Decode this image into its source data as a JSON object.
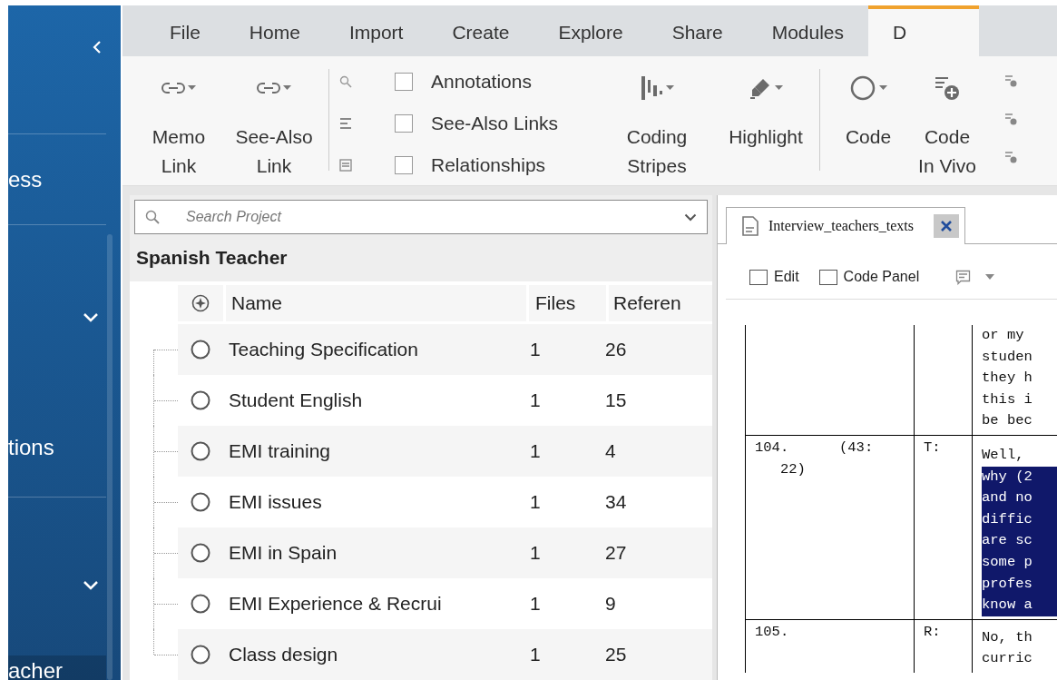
{
  "sidebar": {
    "items": [
      {
        "kind": "heading",
        "label": "ess"
      },
      {
        "kind": "toggle",
        "expanded": false
      },
      {
        "kind": "heading",
        "label": "tions"
      },
      {
        "kind": "toggle",
        "expanded": false
      },
      {
        "kind": "item",
        "label": "acher",
        "selected": true
      }
    ]
  },
  "ribbon": {
    "tabs": [
      {
        "label": "File",
        "selected": false
      },
      {
        "label": "Home",
        "selected": false
      },
      {
        "label": "Import",
        "selected": false
      },
      {
        "label": "Create",
        "selected": false
      },
      {
        "label": "Explore",
        "selected": false
      },
      {
        "label": "Share",
        "selected": false
      },
      {
        "label": "Modules",
        "selected": false
      },
      {
        "label": "D",
        "selected": true
      }
    ],
    "groups": [
      {
        "kind": "buttons",
        "buttons": [
          {
            "lines": [
              "Memo",
              "Link"
            ],
            "dropdown": true
          },
          {
            "lines": [
              "See-Also",
              "Link"
            ],
            "dropdown": true
          }
        ]
      },
      {
        "kind": "checks",
        "items": [
          {
            "label": "Annotations",
            "checked": false
          },
          {
            "label": "See-Also Links",
            "checked": false
          },
          {
            "label": "Relationships",
            "checked": false
          }
        ]
      },
      {
        "kind": "buttons",
        "buttons": [
          {
            "lines": [
              "Coding",
              "Stripes"
            ],
            "dropdown": true
          },
          {
            "lines": [
              "Highlight"
            ],
            "dropdown": true
          }
        ]
      },
      {
        "kind": "buttons",
        "buttons": [
          {
            "lines": [
              "Code"
            ],
            "dropdown": true
          },
          {
            "lines": [
              "Code",
              "In Vivo"
            ],
            "dropdown": false
          }
        ]
      }
    ]
  },
  "project": {
    "search": {
      "placeholder": "Search Project"
    },
    "title": "Spanish Teacher",
    "columns": [
      "Name",
      "Files",
      "Referen"
    ],
    "rows": [
      {
        "name": "Teaching Specification",
        "files": "1",
        "references": "26"
      },
      {
        "name": "Student English",
        "files": "1",
        "references": "15"
      },
      {
        "name": "EMI training",
        "files": "1",
        "references": "4"
      },
      {
        "name": "EMI issues",
        "files": "1",
        "references": "34"
      },
      {
        "name": "EMI in Spain",
        "files": "1",
        "references": "27"
      },
      {
        "name": "EMI Experience & Recrui",
        "files": "1",
        "references": "9"
      },
      {
        "name": "Class design",
        "files": "1",
        "references": "25"
      }
    ]
  },
  "document": {
    "tab": {
      "label": "Interview_teachers_texts"
    },
    "toolbar": {
      "checks": [
        {
          "label": "Edit",
          "checked": false
        },
        {
          "label": "Code Panel",
          "checked": false
        }
      ]
    },
    "transcript": [
      {
        "text_lines": [
          {
            "text": "or my",
            "highlighted": false
          },
          {
            "text": "studen",
            "highlighted": false
          },
          {
            "text": "they h",
            "highlighted": false
          },
          {
            "text": "this i",
            "highlighted": false
          },
          {
            "text": "be bec",
            "highlighted": false
          }
        ]
      },
      {
        "number_lines": [
          "104.      (43:",
          "   22)"
        ],
        "speaker": "T:",
        "text_lines": [
          {
            "text": "Well,",
            "highlighted": false
          },
          {
            "text": "why (2",
            "highlighted": true
          },
          {
            "text": "and no",
            "highlighted": true
          },
          {
            "text": "diffic",
            "highlighted": true
          },
          {
            "text": "are sc",
            "highlighted": true
          },
          {
            "text": "some p",
            "highlighted": true
          },
          {
            "text": "profes",
            "highlighted": true
          },
          {
            "text": "know a",
            "highlighted": true
          }
        ]
      },
      {
        "number_lines": [
          "105."
        ],
        "speaker": "R:",
        "text_lines": [
          {
            "text": "No, th",
            "highlighted": false
          },
          {
            "text": "curric",
            "highlighted": false
          }
        ]
      }
    ]
  }
}
